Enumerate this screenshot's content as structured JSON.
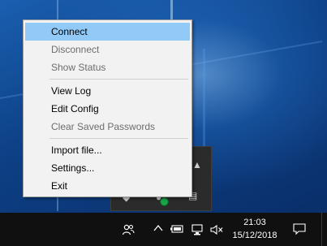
{
  "context_menu": {
    "items": [
      {
        "label": "Connect",
        "state": "highlighted"
      },
      {
        "label": "Disconnect",
        "state": "disabled"
      },
      {
        "label": "Show Status",
        "state": "disabled"
      },
      {
        "label": "View Log",
        "state": "enabled"
      },
      {
        "label": "Edit Config",
        "state": "enabled"
      },
      {
        "label": "Clear Saved Passwords",
        "state": "disabled"
      },
      {
        "label": "Import file...",
        "state": "enabled"
      },
      {
        "label": "Settings...",
        "state": "enabled"
      },
      {
        "label": "Exit",
        "state": "enabled"
      }
    ]
  },
  "taskbar": {
    "time": "21:03",
    "date": "15/12/2018",
    "icons": [
      "people-icon",
      "chevron-up-icon",
      "battery-icon",
      "network-icon",
      "volume-muted-icon",
      "notification-icon"
    ]
  },
  "colors": {
    "menu_highlight": "#91c9f7",
    "menu_background": "#f2f2f2",
    "taskbar": "#101010",
    "disabled_text": "#6d6d6d"
  }
}
